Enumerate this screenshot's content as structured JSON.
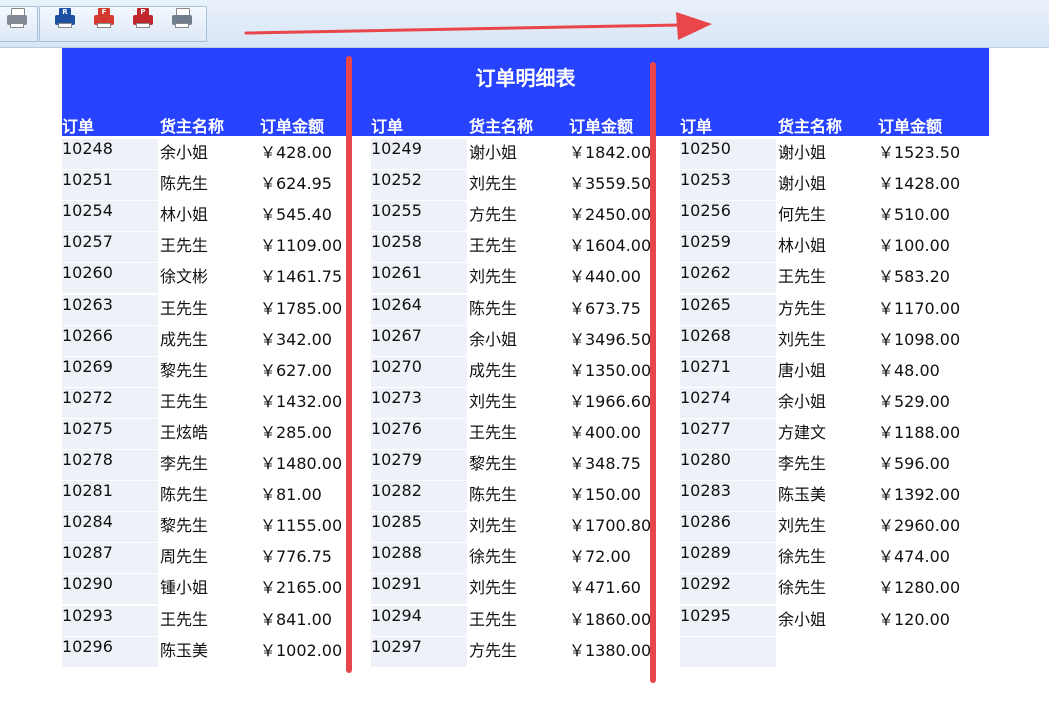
{
  "toolbar": {
    "buttons": [
      {
        "icon": "print-preview-icon",
        "color": "#7f8a96"
      },
      {
        "icon": "print-r-icon",
        "color": "#1d4fa3",
        "letter": "R"
      },
      {
        "icon": "print-f-icon",
        "color": "#d33a2f",
        "letter": "F"
      },
      {
        "icon": "print-p-icon",
        "color": "#c0282d",
        "letter": "P"
      },
      {
        "icon": "printer-icon",
        "color": "#6f7d8c"
      }
    ]
  },
  "report": {
    "title": "订单明细表",
    "header_color": "#2743ff",
    "columns": [
      "订单",
      "货主名称",
      "订单金额"
    ],
    "groups": [
      {
        "rows": [
          [
            "10248",
            "余小姐",
            "￥428.00"
          ],
          [
            "10251",
            "陈先生",
            "￥624.95"
          ],
          [
            "10254",
            "林小姐",
            "￥545.40"
          ],
          [
            "10257",
            "王先生",
            "￥1109.00"
          ],
          [
            "10260",
            "徐文彬",
            "￥1461.75"
          ],
          [
            "10263",
            "王先生",
            "￥1785.00"
          ],
          [
            "10266",
            "成先生",
            "￥342.00"
          ],
          [
            "10269",
            "黎先生",
            "￥627.00"
          ],
          [
            "10272",
            "王先生",
            "￥1432.00"
          ],
          [
            "10275",
            "王炫皓",
            "￥285.00"
          ],
          [
            "10278",
            "李先生",
            "￥1480.00"
          ],
          [
            "10281",
            "陈先生",
            "￥81.00"
          ],
          [
            "10284",
            "黎先生",
            "￥1155.00"
          ],
          [
            "10287",
            "周先生",
            "￥776.75"
          ],
          [
            "10290",
            "锺小姐",
            "￥2165.00"
          ],
          [
            "10293",
            "王先生",
            "￥841.00"
          ],
          [
            "10296",
            "陈玉美",
            "￥1002.00"
          ]
        ]
      },
      {
        "rows": [
          [
            "10249",
            "谢小姐",
            "￥1842.00"
          ],
          [
            "10252",
            "刘先生",
            "￥3559.50"
          ],
          [
            "10255",
            "方先生",
            "￥2450.00"
          ],
          [
            "10258",
            "王先生",
            "￥1604.00"
          ],
          [
            "10261",
            "刘先生",
            "￥440.00"
          ],
          [
            "10264",
            "陈先生",
            "￥673.75"
          ],
          [
            "10267",
            "余小姐",
            "￥3496.50"
          ],
          [
            "10270",
            "成先生",
            "￥1350.00"
          ],
          [
            "10273",
            "刘先生",
            "￥1966.60"
          ],
          [
            "10276",
            "王先生",
            "￥400.00"
          ],
          [
            "10279",
            "黎先生",
            "￥348.75"
          ],
          [
            "10282",
            "陈先生",
            "￥150.00"
          ],
          [
            "10285",
            "刘先生",
            "￥1700.80"
          ],
          [
            "10288",
            "徐先生",
            "￥72.00"
          ],
          [
            "10291",
            "刘先生",
            "￥471.60"
          ],
          [
            "10294",
            "王先生",
            "￥1860.00"
          ],
          [
            "10297",
            "方先生",
            "￥1380.00"
          ]
        ]
      },
      {
        "rows": [
          [
            "10250",
            "谢小姐",
            "￥1523.50"
          ],
          [
            "10253",
            "谢小姐",
            "￥1428.00"
          ],
          [
            "10256",
            "何先生",
            "￥510.00"
          ],
          [
            "10259",
            "林小姐",
            "￥100.00"
          ],
          [
            "10262",
            "王先生",
            "￥583.20"
          ],
          [
            "10265",
            "方先生",
            "￥1170.00"
          ],
          [
            "10268",
            "刘先生",
            "￥1098.00"
          ],
          [
            "10271",
            "唐小姐",
            "￥48.00"
          ],
          [
            "10274",
            "余小姐",
            "￥529.00"
          ],
          [
            "10277",
            "方建文",
            "￥1188.00"
          ],
          [
            "10280",
            "李先生",
            "￥596.00"
          ],
          [
            "10283",
            "陈玉美",
            "￥1392.00"
          ],
          [
            "10286",
            "刘先生",
            "￥2960.00"
          ],
          [
            "10289",
            "徐先生",
            "￥474.00"
          ],
          [
            "10292",
            "徐先生",
            "￥1280.00"
          ],
          [
            "10295",
            "余小姐",
            "￥120.00"
          ],
          [
            "",
            "",
            ""
          ]
        ]
      }
    ]
  },
  "annotation_color": "#e8464b"
}
